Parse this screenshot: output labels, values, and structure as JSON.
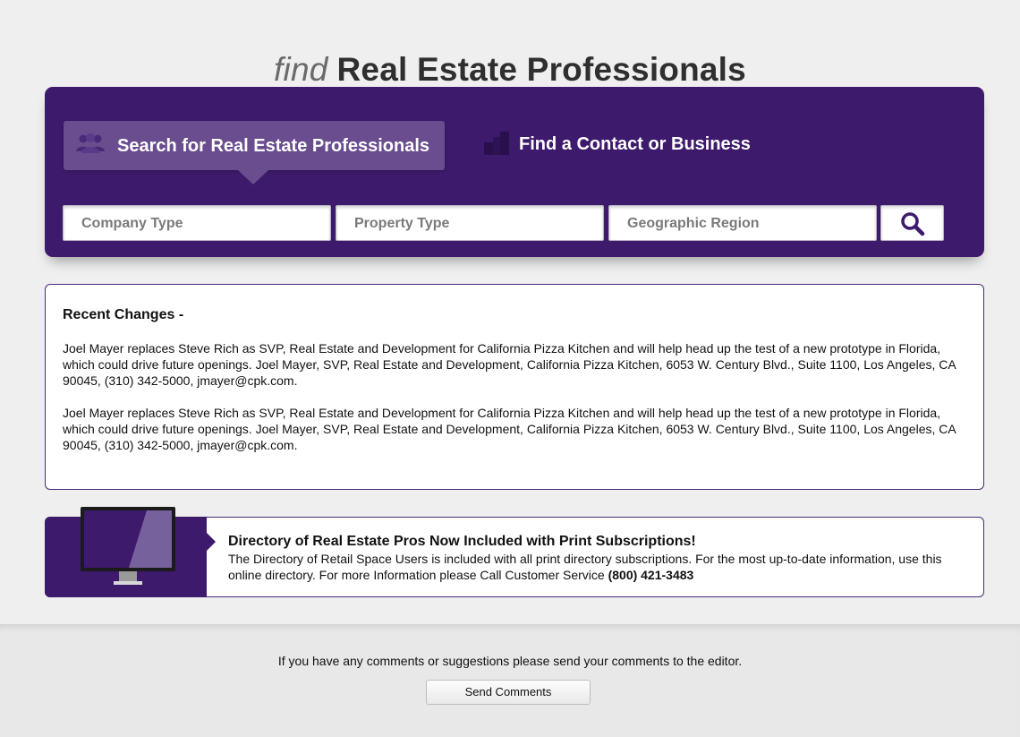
{
  "header": {
    "title_prefix": "find",
    "title_main": "Real Estate Professionals"
  },
  "tabs": [
    {
      "label": "Search for Real Estate Professionals",
      "icon": "people-icon",
      "active": true
    },
    {
      "label": "Find a Contact or Business",
      "icon": "buildings-icon",
      "active": false
    }
  ],
  "search": {
    "company_type_placeholder": "Company Type",
    "property_type_placeholder": "Property Type",
    "geographic_region_placeholder": "Geographic Region",
    "button_icon": "search-icon"
  },
  "recent": {
    "title": "Recent Changes -",
    "items": [
      "Joel Mayer replaces Steve Rich as SVP, Real Estate and Development for California Pizza Kitchen and will help head up the test of a new prototype in Florida, which could drive future openings.  Joel Mayer, SVP, Real Estate and Development, California Pizza Kitchen, 6053 W. Century Blvd., Suite 1100, Los Angeles, CA 90045, (310) 342-5000, jmayer@cpk.com.",
      "Joel Mayer replaces Steve Rich as SVP, Real Estate and Development for California Pizza Kitchen and will help head up the test of a new prototype in Florida, which could drive future openings.  Joel Mayer, SVP, Real Estate and Development, California Pizza Kitchen, 6053 W. Century Blvd., Suite 1100, Los Angeles, CA 90045, (310) 342-5000, jmayer@cpk.com."
    ]
  },
  "promo": {
    "title": "Directory of Real Estate Pros Now Included with Print Subscriptions!",
    "body": "The Directory of Retail Space Users is included with all print directory subscriptions. For the most up-to-date information, use this online directory. For more Information please Call Customer Service ",
    "phone": "(800) 421-3483",
    "image_icon": "monitor-icon"
  },
  "footer": {
    "text": "If you have any comments or suggestions please send your comments to the editor.",
    "button_label": "Send Comments"
  },
  "colors": {
    "brand_purple": "#3d1a6b",
    "active_tab": "#6a4d8f",
    "page_bg": "#efefef"
  }
}
